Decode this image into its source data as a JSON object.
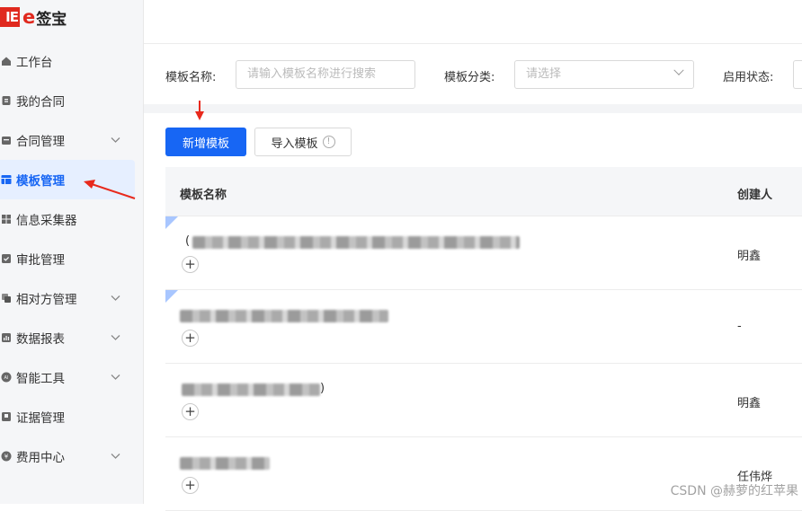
{
  "logo": {
    "mark": "IE",
    "text": "签宝",
    "e": "e"
  },
  "sidebar": {
    "items": [
      {
        "label": "工作台",
        "icon": "home-icon",
        "chevron": false
      },
      {
        "label": "我的合同",
        "icon": "contract-icon",
        "chevron": false
      },
      {
        "label": "合同管理",
        "icon": "folder-icon",
        "chevron": true
      },
      {
        "label": "模板管理",
        "icon": "template-icon",
        "chevron": false,
        "active": true
      },
      {
        "label": "信息采集器",
        "icon": "grid-icon",
        "chevron": false
      },
      {
        "label": "审批管理",
        "icon": "approval-icon",
        "chevron": false
      },
      {
        "label": "相对方管理",
        "icon": "counterparty-icon",
        "chevron": true
      },
      {
        "label": "数据报表",
        "icon": "chart-icon",
        "chevron": true
      },
      {
        "label": "智能工具",
        "icon": "ai-icon",
        "chevron": true
      },
      {
        "label": "证据管理",
        "icon": "evidence-icon",
        "chevron": false
      },
      {
        "label": "费用中心",
        "icon": "fee-icon",
        "chevron": true
      }
    ]
  },
  "filters": {
    "name_label": "模板名称:",
    "name_placeholder": "请输入模板名称进行搜索",
    "category_label": "模板分类:",
    "category_placeholder": "请选择",
    "status_label": "启用状态:"
  },
  "toolbar": {
    "add_label": "新增模板",
    "import_label": "导入模板"
  },
  "table": {
    "columns": [
      "模板名称",
      "创建人"
    ],
    "rows": [
      {
        "name": "(",
        "creator": "明鑫",
        "has_corner": true
      },
      {
        "name": "",
        "creator": "-",
        "has_corner": true
      },
      {
        "name": ")",
        "creator": "明鑫",
        "has_corner": false
      },
      {
        "name": "",
        "creator": "任伟烨",
        "has_corner": false
      }
    ]
  },
  "watermark": "CSDN @赫萝的红苹果",
  "colors": {
    "accent": "#1766f4",
    "brand": "#e0291e",
    "annotation": "#e8291c"
  }
}
